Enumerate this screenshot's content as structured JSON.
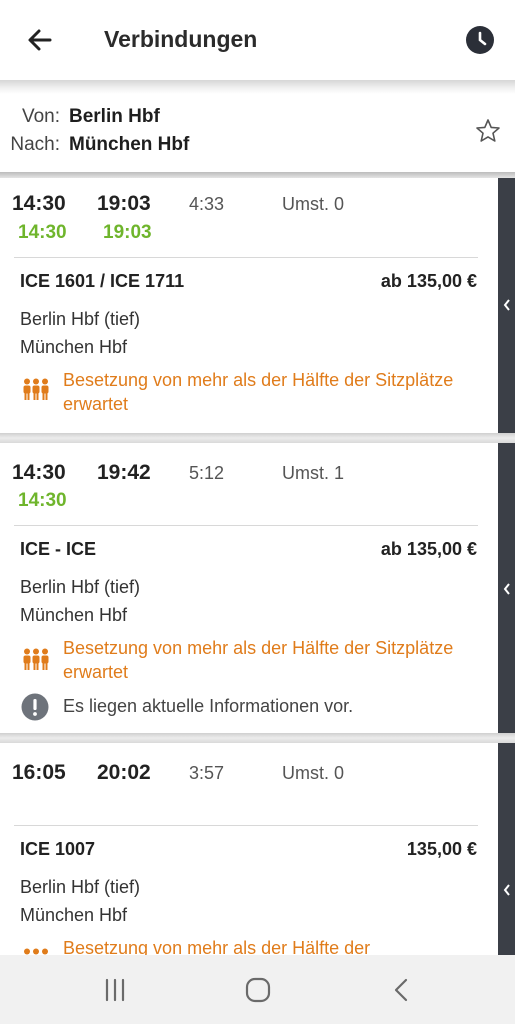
{
  "appbar": {
    "title": "Verbindungen",
    "back_icon": "arrow-left-icon",
    "history_icon": "clock-icon"
  },
  "route": {
    "from_label": "Von:",
    "from_value": "Berlin Hbf",
    "to_label": "Nach:",
    "to_value": "München Hbf",
    "favorite_icon": "star-outline-icon"
  },
  "connections": [
    {
      "dep": "14:30",
      "arr": "19:03",
      "duration": "4:33",
      "changes": "Umst. 0",
      "dep_realtime": "14:30",
      "arr_realtime": "19:03",
      "train": "ICE 1601 / ICE 1711",
      "price": "ab 135,00 €",
      "from_station": "Berlin Hbf (tief)",
      "to_station": "München Hbf",
      "occupancy": "Besetzung von mehr als der Hälfte der Sitzplätze erwartet"
    },
    {
      "dep": "14:30",
      "arr": "19:42",
      "duration": "5:12",
      "changes": "Umst. 1",
      "dep_realtime": "14:30",
      "train": "ICE - ICE",
      "price": "ab 135,00 €",
      "from_station": "Berlin Hbf (tief)",
      "to_station": "München Hbf",
      "occupancy": "Besetzung von mehr als der Hälfte der Sitzplätze erwartet",
      "info": "Es liegen aktuelle Informationen vor."
    },
    {
      "dep": "16:05",
      "arr": "20:02",
      "duration": "3:57",
      "changes": "Umst. 0",
      "train": "ICE 1007",
      "price": "135,00 €",
      "from_station": "Berlin Hbf (tief)",
      "to_station": "München Hbf",
      "occupancy": "Besetzung von mehr als der Hälfte der"
    }
  ],
  "colors": {
    "realtime_green": "#6fb52c",
    "occupancy_orange": "#e07c1b",
    "rail_dark": "#3b3f47"
  },
  "navbar": {
    "recents_icon": "recent-apps-icon",
    "home_icon": "home-icon",
    "back_icon": "system-back-icon"
  }
}
